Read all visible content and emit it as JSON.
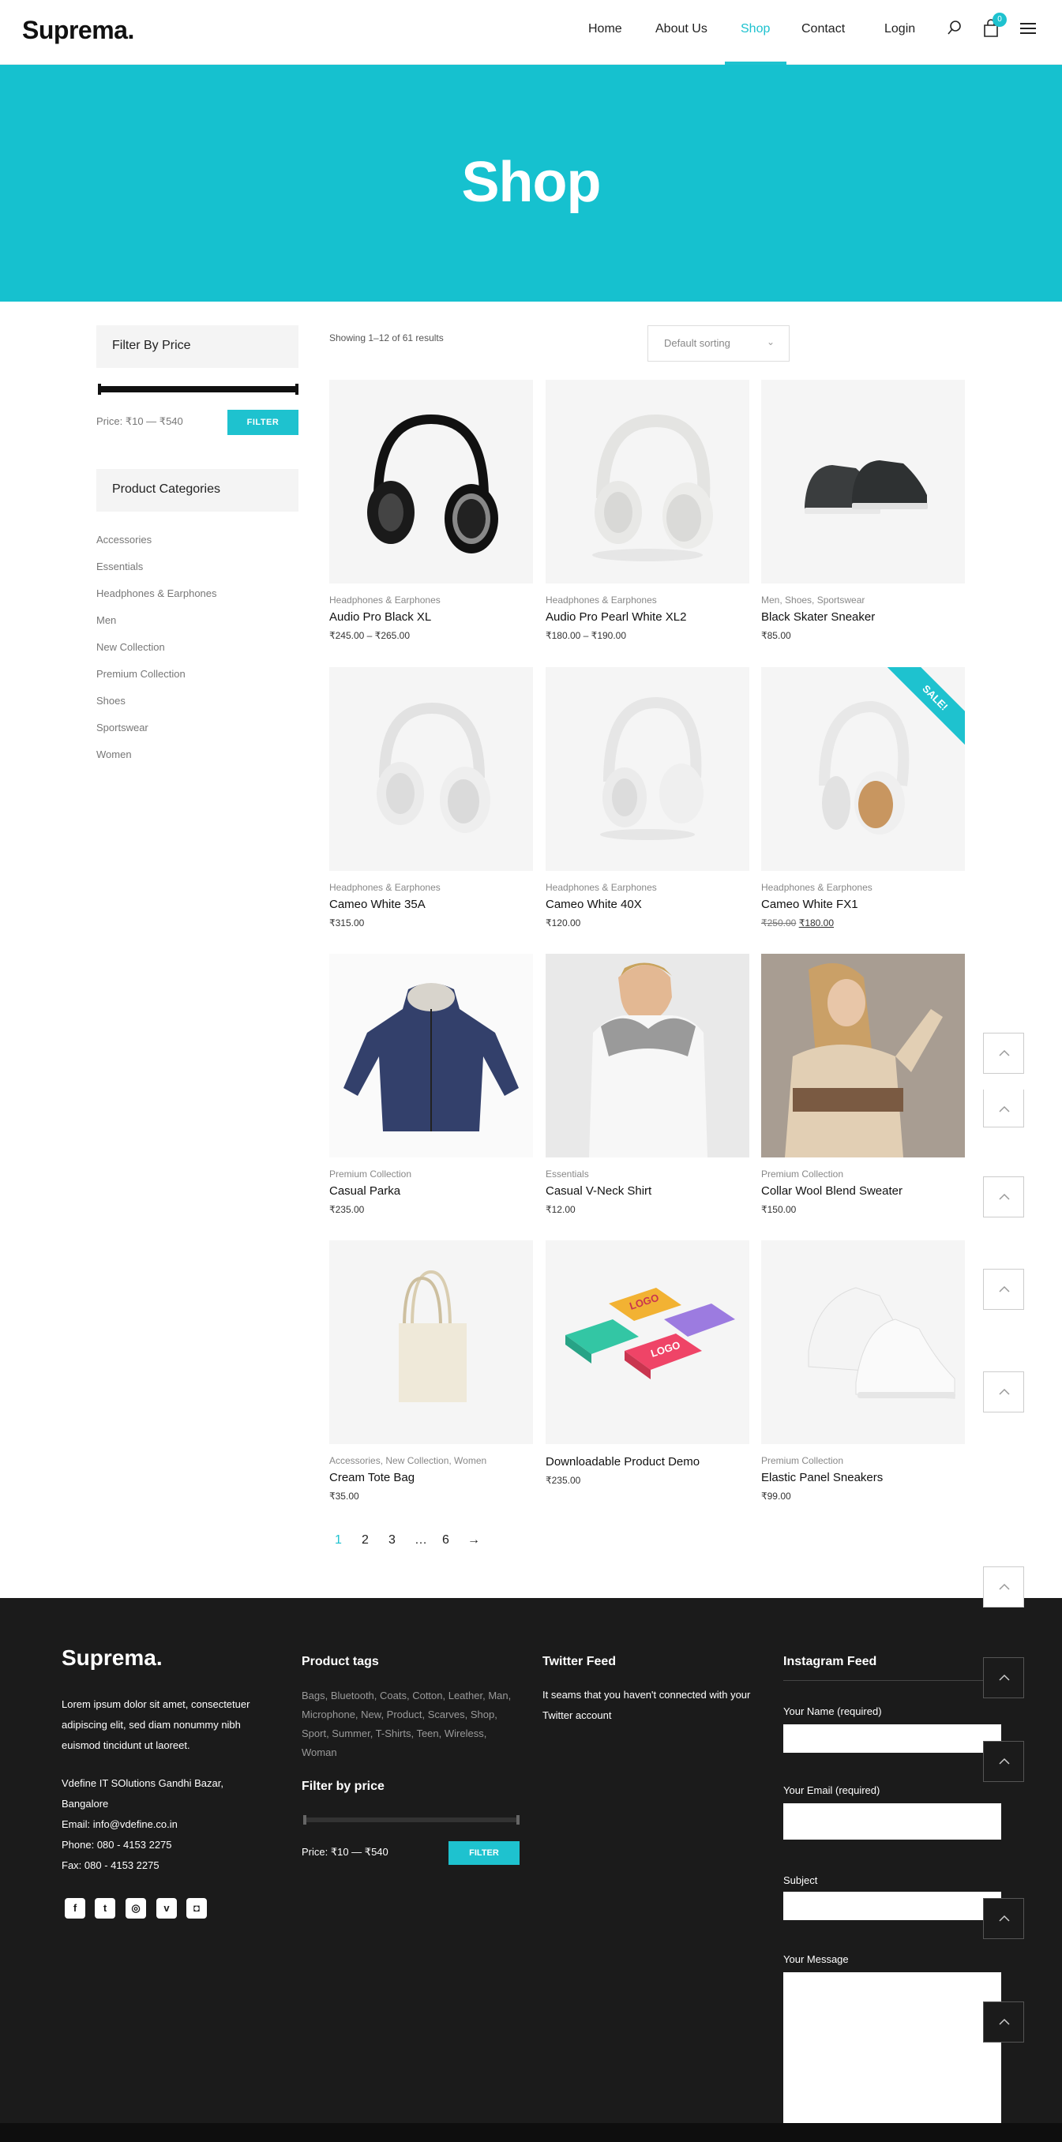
{
  "header": {
    "logo": "Suprema.",
    "nav": [
      "Home",
      "About Us",
      "Shop",
      "Contact",
      "Login"
    ],
    "active": "Shop",
    "cart_count": "0",
    "icons": [
      "search-icon",
      "cart-icon",
      "menu-icon"
    ]
  },
  "hero": {
    "title": "Shop"
  },
  "sidebar": {
    "filter_title": "Filter By Price",
    "price_label": "Price: ₹10 — ₹540",
    "filter_button": "FILTER",
    "categories_title": "Product Categories",
    "categories": [
      "Accessories",
      "Essentials",
      "Headphones & Earphones",
      "Men",
      "New Collection",
      "Premium Collection",
      "Shoes",
      "Sportswear",
      "Women"
    ]
  },
  "toolbar": {
    "results": "Showing 1–12 of 61 results",
    "sorting": "Default sorting"
  },
  "products": [
    {
      "cat": "Headphones & Earphones",
      "name": "Audio Pro Black XL",
      "price": "₹245.00 – ₹265.00"
    },
    {
      "cat": "Headphones & Earphones",
      "name": "Audio Pro Pearl White XL2",
      "price": "₹180.00 – ₹190.00"
    },
    {
      "cat": "Men, Shoes, Sportswear",
      "name": "Black Skater Sneaker",
      "price": "₹85.00"
    },
    {
      "cat": "Headphones & Earphones",
      "name": "Cameo White 35A",
      "price": "₹315.00"
    },
    {
      "cat": "Headphones & Earphones",
      "name": "Cameo White 40X",
      "price": "₹120.00"
    },
    {
      "cat": "Headphones & Earphones",
      "name": "Cameo White FX1",
      "old_price": "₹250.00",
      "price": "₹180.00",
      "badge": "SALE!"
    },
    {
      "cat": "Premium Collection",
      "name": "Casual Parka",
      "price": "₹235.00"
    },
    {
      "cat": "Essentials",
      "name": "Casual V-Neck Shirt",
      "price": "₹12.00"
    },
    {
      "cat": "Premium Collection",
      "name": "Collar Wool Blend Sweater",
      "price": "₹150.00"
    },
    {
      "cat": "Accessories, New Collection, Women",
      "name": "Cream Tote Bag",
      "price": "₹35.00"
    },
    {
      "cat": "",
      "name": "Downloadable Product Demo",
      "price": "₹235.00",
      "logo_text": "LOGO"
    },
    {
      "cat": "Premium Collection",
      "name": "Elastic Panel Sneakers",
      "price": "₹99.00"
    }
  ],
  "pagination": [
    "1",
    "2",
    "3",
    "…",
    "6",
    "→"
  ],
  "footer": {
    "logo": "Suprema.",
    "about": "Lorem ipsum dolor sit amet, consectetuer adipiscing elit, sed diam nonummy nibh euismod tincidunt ut laoreet.",
    "address": "Vdefine IT SOlutions Gandhi Bazar, Bangalore",
    "email": "Email: info@vdefine.co.in",
    "phone": "Phone: 080 - 4153 2275",
    "fax": "Fax: 080 - 4153 2275",
    "social": [
      "facebook-icon",
      "twitter-icon",
      "dribbble-icon",
      "vimeo-icon",
      "instagram-icon"
    ],
    "tags_title": "Product tags",
    "tags": "Bags, Bluetooth, Coats, Cotton, Leather, Man, Microphone, New, Product, Scarves, Shop, Sport, Summer, T-Shirts, Teen, Wireless, Woman",
    "filter_title": "Filter by price",
    "price_label": "Price: ₹10 — ₹540",
    "filter_button": "FILTER",
    "twitter_title": "Twitter Feed",
    "twitter_text": "It seams that you haven't connected with your Twitter account",
    "instagram_title": "Instagram Feed",
    "form": {
      "name": "Your Name (required)",
      "email": "Your Email (required)",
      "subject": "Subject",
      "message": "Your Message"
    }
  },
  "colors": {
    "accent": "#1ec2cf",
    "hero": "#16c1cf",
    "footer": "#1b1b1b"
  }
}
